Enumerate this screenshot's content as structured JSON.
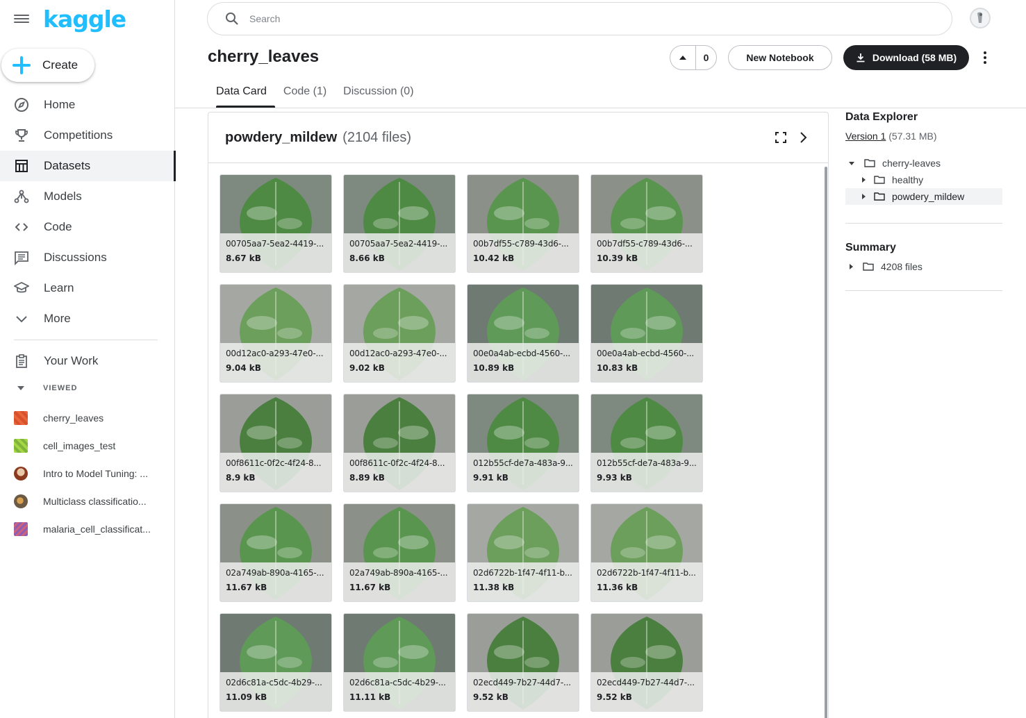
{
  "sidebar": {
    "logo": "kaggle",
    "create_label": "Create",
    "nav": [
      {
        "label": "Home",
        "icon": "compass-icon"
      },
      {
        "label": "Competitions",
        "icon": "trophy-icon"
      },
      {
        "label": "Datasets",
        "icon": "table-icon",
        "active": true
      },
      {
        "label": "Models",
        "icon": "models-icon"
      },
      {
        "label": "Code",
        "icon": "code-icon"
      },
      {
        "label": "Discussions",
        "icon": "discussions-icon"
      },
      {
        "label": "Learn",
        "icon": "graduation-cap-icon"
      },
      {
        "label": "More",
        "icon": "chevron-down-icon"
      }
    ],
    "your_work": "Your Work",
    "viewed_label": "VIEWED",
    "recent": [
      {
        "label": "cherry_leaves",
        "color": "#e86a3f"
      },
      {
        "label": "cell_images_test",
        "color": "#9ccc3c"
      },
      {
        "label": "Intro to Model Tuning: ...",
        "color": "#b0603a"
      },
      {
        "label": "Multiclass classificatio...",
        "color": "#8a7a5c"
      },
      {
        "label": "malaria_cell_classificat...",
        "color": "#8e5fb0"
      }
    ]
  },
  "header": {
    "search_placeholder": "Search",
    "title": "cherry_leaves",
    "vote_count": "0",
    "new_notebook": "New Notebook",
    "download": "Download (58 MB)"
  },
  "tabs": [
    {
      "label": "Data Card",
      "active": true
    },
    {
      "label": "Code (1)"
    },
    {
      "label": "Discussion (0)"
    }
  ],
  "panel": {
    "folder": "powdery_mildew",
    "count": "(2104 files)",
    "files": [
      {
        "name": "00705aa7-5ea2-4419-...",
        "size": "8.67 kB"
      },
      {
        "name": "00705aa7-5ea2-4419-...",
        "size": "8.66 kB"
      },
      {
        "name": "00b7df55-c789-43d6-...",
        "size": "10.42 kB"
      },
      {
        "name": "00b7df55-c789-43d6-...",
        "size": "10.39 kB"
      },
      {
        "name": "00d12ac0-a293-47e0-...",
        "size": "9.04 kB"
      },
      {
        "name": "00d12ac0-a293-47e0-...",
        "size": "9.02 kB"
      },
      {
        "name": "00e0a4ab-ecbd-4560-...",
        "size": "10.89 kB"
      },
      {
        "name": "00e0a4ab-ecbd-4560-...",
        "size": "10.83 kB"
      },
      {
        "name": "00f8611c-0f2c-4f24-8...",
        "size": "8.9 kB"
      },
      {
        "name": "00f8611c-0f2c-4f24-8...",
        "size": "8.89 kB"
      },
      {
        "name": "012b55cf-de7a-483a-9...",
        "size": "9.91 kB"
      },
      {
        "name": "012b55cf-de7a-483a-9...",
        "size": "9.93 kB"
      },
      {
        "name": "02a749ab-890a-4165-...",
        "size": "11.67 kB"
      },
      {
        "name": "02a749ab-890a-4165-...",
        "size": "11.67 kB"
      },
      {
        "name": "02d6722b-1f47-4f11-b...",
        "size": "11.38 kB"
      },
      {
        "name": "02d6722b-1f47-4f11-b...",
        "size": "11.36 kB"
      },
      {
        "name": "02d6c81a-c5dc-4b29-...",
        "size": "11.09 kB"
      },
      {
        "name": "02d6c81a-c5dc-4b29-...",
        "size": "11.11 kB"
      },
      {
        "name": "02ecd449-7b27-44d7-...",
        "size": "9.52 kB"
      },
      {
        "name": "02ecd449-7b27-44d7-...",
        "size": "9.52 kB"
      }
    ]
  },
  "explorer": {
    "title": "Data Explorer",
    "version_link": "Version 1",
    "version_size": "(57.31 MB)",
    "tree": [
      {
        "label": "cherry-leaves",
        "expanded": true,
        "level": 0
      },
      {
        "label": "healthy",
        "level": 1
      },
      {
        "label": "powdery_mildew",
        "level": 1,
        "selected": true
      }
    ],
    "summary_title": "Summary",
    "summary_files": "4208 files"
  }
}
